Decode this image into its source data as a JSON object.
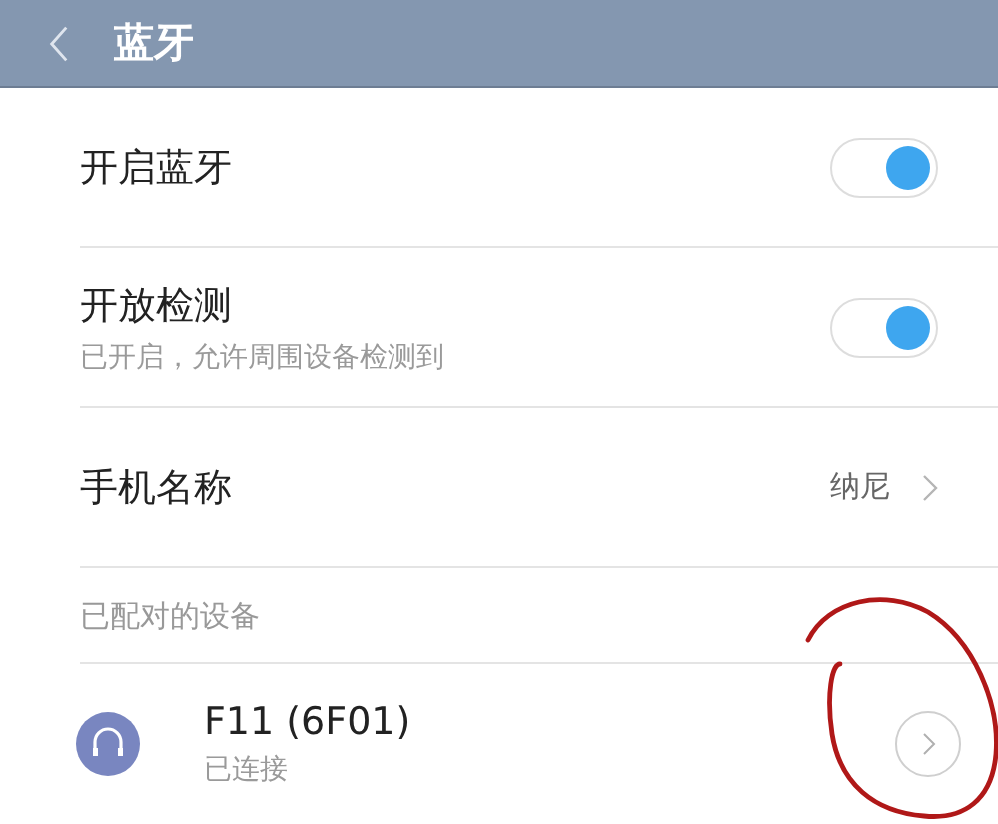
{
  "header": {
    "title": "蓝牙"
  },
  "settings": [
    {
      "kind": "toggle",
      "label": "开启蓝牙",
      "on": true
    },
    {
      "kind": "toggle",
      "label": "开放检测",
      "subtitle": "已开启，允许周围设备检测到",
      "on": true
    },
    {
      "kind": "value",
      "label": "手机名称",
      "value": "纳尼"
    }
  ],
  "paired_section": {
    "heading": "已配对的设备",
    "devices": [
      {
        "name": "F11 (6F01)",
        "status": "已连接"
      }
    ]
  },
  "annotation": {
    "kind": "hand-drawn-circle"
  }
}
